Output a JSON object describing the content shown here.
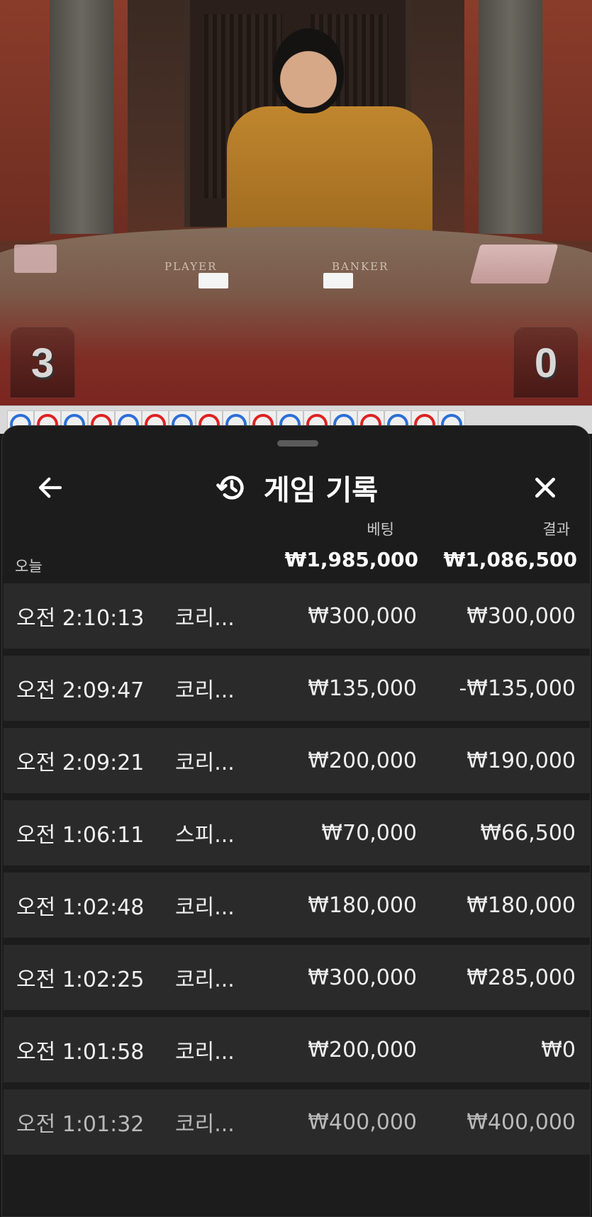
{
  "video": {
    "table_player_label": "PLAYER",
    "table_banker_label": "BANKER",
    "player_score": "3",
    "banker_score": "0"
  },
  "road": {
    "dots": [
      "blue",
      "red",
      "blue",
      "red",
      "blue",
      "red",
      "blue",
      "red",
      "blue",
      "red",
      "blue",
      "red",
      "blue",
      "red",
      "blue",
      "red",
      "blue"
    ]
  },
  "sheet": {
    "title": "게임 기록",
    "back_icon": "arrow-left-icon",
    "history_icon": "history-icon",
    "close_icon": "close-icon",
    "columns": {
      "bet": "베팅",
      "result": "결과"
    },
    "summary": {
      "label": "오늘",
      "bet_total": "₩1,985,000",
      "result_total": "₩1,086,500"
    },
    "rows": [
      {
        "time": "오전 2:10:13",
        "game": "코리...",
        "bet": "₩300,000",
        "result": "₩300,000"
      },
      {
        "time": "오전 2:09:47",
        "game": "코리...",
        "bet": "₩135,000",
        "result": "-₩135,000"
      },
      {
        "time": "오전 2:09:21",
        "game": "코리...",
        "bet": "₩200,000",
        "result": "₩190,000"
      },
      {
        "time": "오전 1:06:11",
        "game": "스피...",
        "bet": "₩70,000",
        "result": "₩66,500"
      },
      {
        "time": "오전 1:02:48",
        "game": "코리...",
        "bet": "₩180,000",
        "result": "₩180,000"
      },
      {
        "time": "오전 1:02:25",
        "game": "코리...",
        "bet": "₩300,000",
        "result": "₩285,000"
      },
      {
        "time": "오전 1:01:58",
        "game": "코리...",
        "bet": "₩200,000",
        "result": "₩0"
      },
      {
        "time": "오전 1:01:32",
        "game": "코리...",
        "bet": "₩400,000",
        "result": "₩400,000"
      }
    ]
  }
}
